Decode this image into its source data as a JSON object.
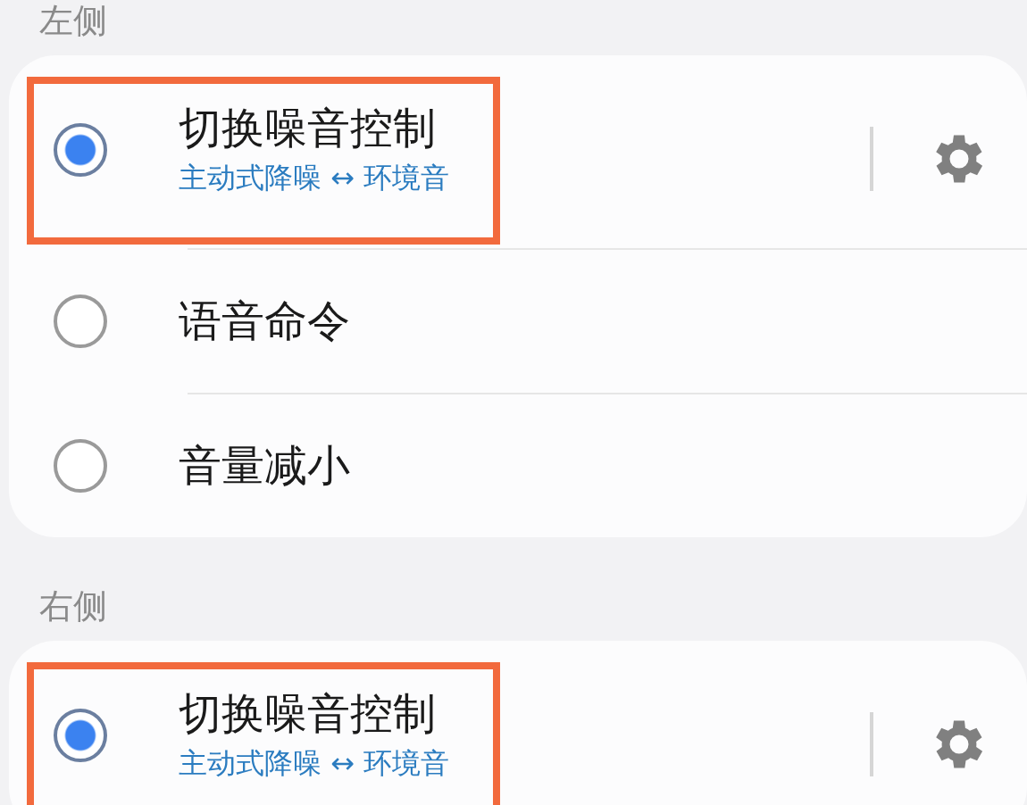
{
  "sections": [
    {
      "label": "左侧",
      "options": [
        {
          "title": "切换噪音控制",
          "subtitle": "主动式降噪 ↔ 环境音",
          "selected": true,
          "highlighted": true,
          "settings": true
        },
        {
          "title": "语音命令",
          "selected": false,
          "highlighted": false,
          "settings": false
        },
        {
          "title": "音量减小",
          "selected": false,
          "highlighted": false,
          "settings": false
        }
      ]
    },
    {
      "label": "右侧",
      "options": [
        {
          "title": "切换噪音控制",
          "subtitle": "主动式降噪 ↔ 环境音",
          "selected": true,
          "highlighted": true,
          "settings": true
        }
      ]
    }
  ]
}
